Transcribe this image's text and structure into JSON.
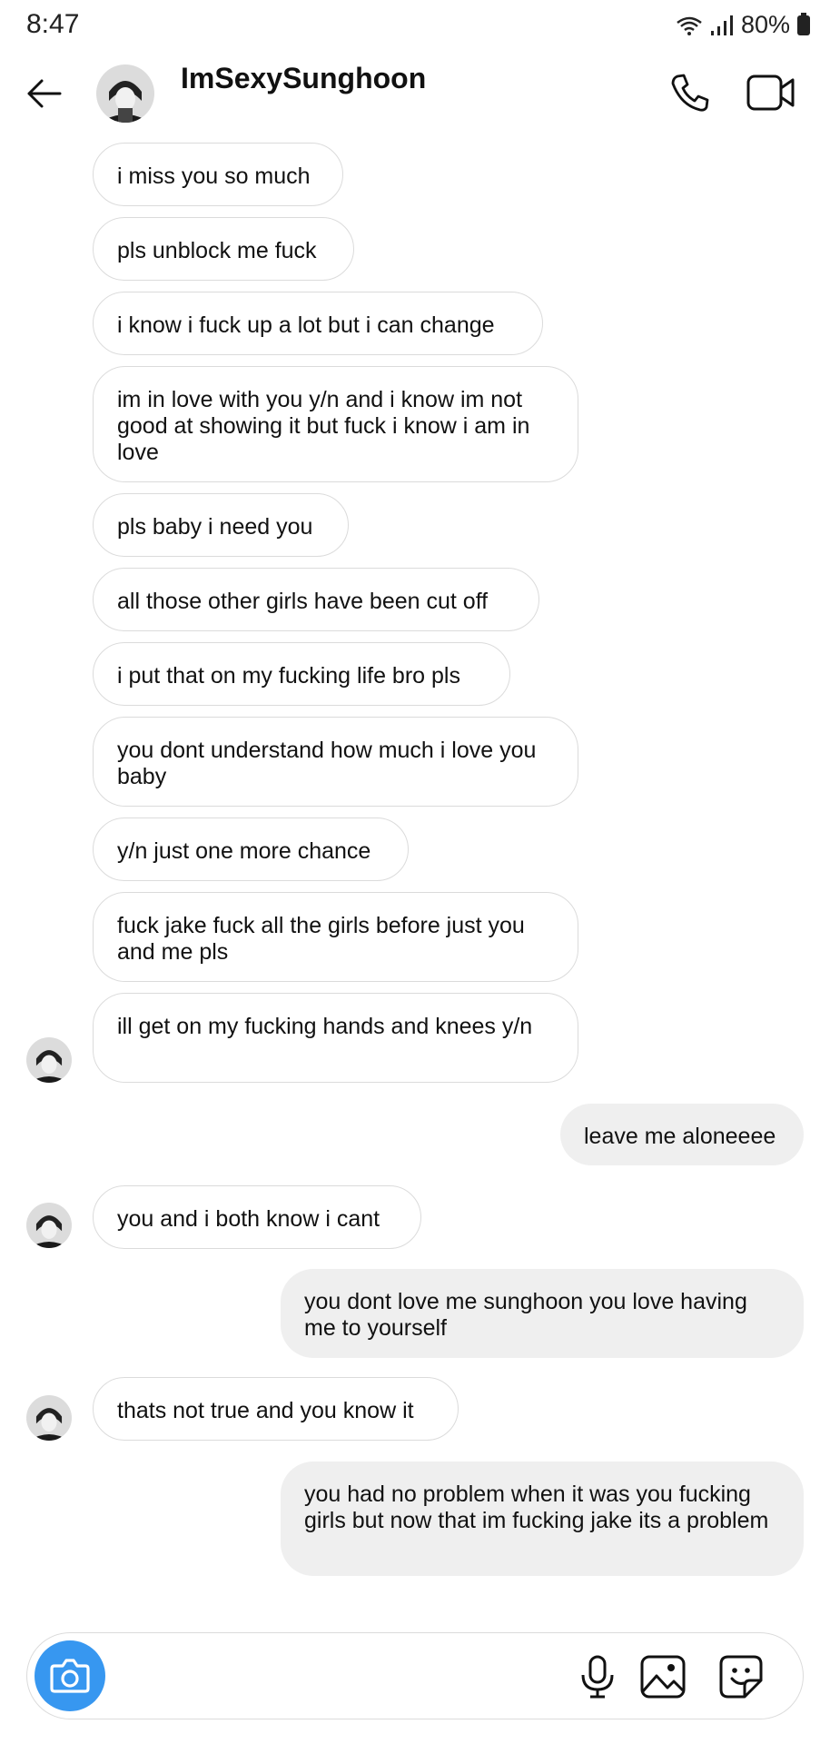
{
  "status_bar": {
    "time": "8:47",
    "battery": "80%"
  },
  "header": {
    "title": "ImSexySunghoon"
  },
  "messages": [
    {
      "text": "i miss you so much",
      "direction": "received"
    },
    {
      "text": "pls unblock me fuck",
      "direction": "received"
    },
    {
      "text": "i know i fuck up a lot but i can change",
      "direction": "received"
    },
    {
      "text": "im in love with you y/n and i know im not good at showing it but fuck i know i am in love",
      "direction": "received"
    },
    {
      "text": "pls baby i need you",
      "direction": "received"
    },
    {
      "text": "all those other girls have been cut off",
      "direction": "received"
    },
    {
      "text": "i put that on my fucking life bro pls",
      "direction": "received"
    },
    {
      "text": "you dont understand how much i love you baby",
      "direction": "received"
    },
    {
      "text": "y/n just one more chance",
      "direction": "received"
    },
    {
      "text": "fuck jake fuck all the girls before just you and me pls",
      "direction": "received"
    },
    {
      "text": "ill get on my fucking hands and knees y/n",
      "direction": "received"
    },
    {
      "text": "leave me aloneeee",
      "direction": "sent"
    },
    {
      "text": "you and i both know i cant",
      "direction": "received"
    },
    {
      "text": "you dont love me sunghoon you love having me to yourself",
      "direction": "sent"
    },
    {
      "text": "thats not true and you know it",
      "direction": "received"
    },
    {
      "text": "you had no problem when it was you fucking girls but now that im fucking jake its a problem",
      "direction": "sent"
    }
  ],
  "icons": {
    "back": "arrow-left-icon",
    "call": "phone-icon",
    "video": "video-camera-icon",
    "camera": "camera-icon",
    "mic": "microphone-icon",
    "gallery": "image-icon",
    "sticker": "sticker-icon"
  },
  "colors": {
    "accent": "#3797f0",
    "sent_bubble": "#efefef",
    "received_border": "#dbdbdb"
  }
}
